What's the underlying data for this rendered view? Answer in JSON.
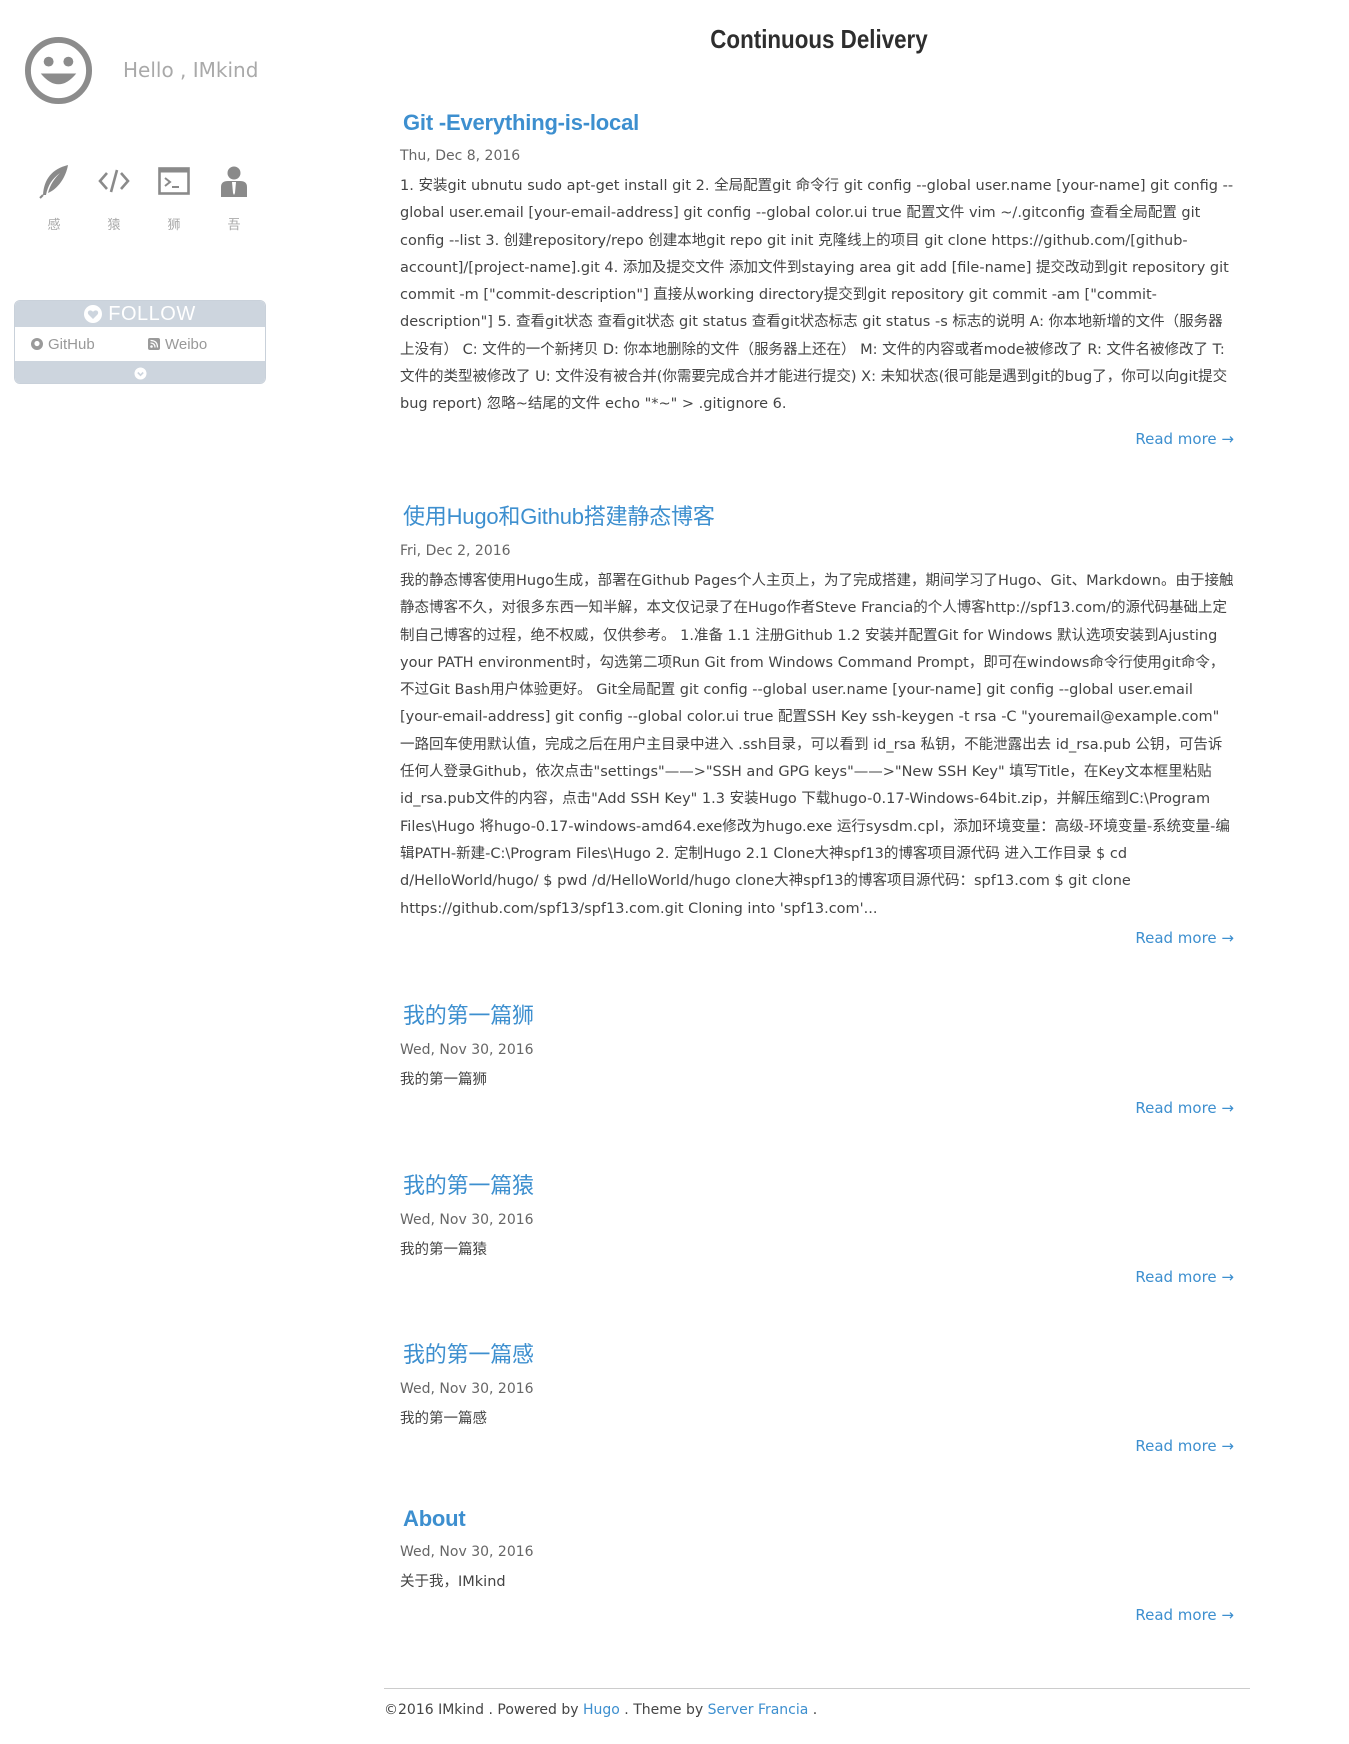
{
  "site": {
    "title": "Continuous Delivery",
    "greeting": "Hello , IMkind"
  },
  "sidebar": {
    "categories": [
      {
        "icon": "feather-icon",
        "label": "感"
      },
      {
        "icon": "code-icon",
        "label": "猿"
      },
      {
        "icon": "terminal-icon",
        "label": "狮"
      },
      {
        "icon": "user-icon",
        "label": "吾"
      }
    ],
    "follow": {
      "heading": "FOLLOW",
      "links": [
        {
          "icon": "github-icon",
          "label": "GitHub"
        },
        {
          "icon": "weibo-icon",
          "label": "Weibo"
        }
      ]
    }
  },
  "posts": [
    {
      "title": "Git -Everything-is-local",
      "date": "Thu, Dec 8, 2016",
      "summary": "1. 安装git ubnutu sudo apt-get install git 2. 全局配置git 命令行 git config --global user.name [your-name] git config --global user.email [your-email-address] git config --global color.ui true 配置文件 vim ~/.gitconfig 查看全局配置 git config --list 3. 创建repository/repo 创建本地git repo git init 克隆线上的项目 git clone https://github.com/[github-account]/[project-name].git 4. 添加及提交文件 添加文件到staying area git add [file-name] 提交改动到git repository git commit -m [\"commit-description\"] 直接从working directory提交到git repository git commit -am [\"commit-description\"] 5. 查看git状态 查看git状态 git status 查看git状态标志 git status -s 标志的说明 A: 你本地新增的文件（服务器上没有） C: 文件的一个新拷贝 D: 你本地删除的文件（服务器上还在） M: 文件的内容或者mode被修改了 R: 文件名被修改了 T: 文件的类型被修改了 U: 文件没有被合并(你需要完成合并才能进行提交) X: 未知状态(很可能是遇到git的bug了，你可以向git提交bug report) 忽略~结尾的文件 echo \"*~\" > .gitignore 6.",
      "read_more": "Read more →"
    },
    {
      "title": "使用Hugo和Github搭建静态博客",
      "date": "Fri, Dec 2, 2016",
      "summary": "我的静态博客使用Hugo生成，部署在Github Pages个人主页上，为了完成搭建，期间学习了Hugo、Git、Markdown。由于接触静态博客不久，对很多东西一知半解，本文仅记录了在Hugo作者Steve Francia的个人博客http://spf13.com/的源代码基础上定制自己博客的过程，绝不权威，仅供参考。 1.准备 1.1 注册Github 1.2 安装并配置Git for Windows 默认选项安装到Ajusting your PATH environment时，勾选第二项Run Git from Windows Command Prompt，即可在windows命令行使用git命令，不过Git Bash用户体验更好。 Git全局配置 git config --global user.name [your-name] git config --global user.email [your-email-address] git config --global color.ui true 配置SSH Key ssh-keygen -t rsa -C \"youremail@example.com\" 一路回车使用默认值，完成之后在用户主目录中进入 .ssh目录，可以看到 id_rsa 私钥，不能泄露出去 id_rsa.pub 公钥，可告诉任何人登录Github，依次点击\"settings\"——>\"SSH and GPG keys\"——>\"New SSH Key\" 填写Title，在Key文本框里粘贴id_rsa.pub文件的内容，点击\"Add SSH Key\" 1.3 安装Hugo 下载hugo-0.17-Windows-64bit.zip，并解压缩到C:\\Program Files\\Hugo 将hugo-0.17-windows-amd64.exe修改为hugo.exe 运行sysdm.cpl，添加环境变量：高级-环境变量-系统变量-编辑PATH-新建-C:\\Program Files\\Hugo 2. 定制Hugo 2.1 Clone大神spf13的博客项目源代码 进入工作目录 $ cd d/HelloWorld/hugo/ $ pwd /d/HelloWorld/hugo clone大神spf13的博客项目源代码：spf13.com $ git clone https://github.com/spf13/spf13.com.git Cloning into 'spf13.com'...",
      "read_more": "Read more →"
    },
    {
      "title": "我的第一篇狮",
      "date": "Wed, Nov 30, 2016",
      "summary": "我的第一篇狮",
      "read_more": "Read more →"
    },
    {
      "title": "我的第一篇猿",
      "date": "Wed, Nov 30, 2016",
      "summary": "我的第一篇猿",
      "read_more": "Read more →"
    },
    {
      "title": "我的第一篇感",
      "date": "Wed, Nov 30, 2016",
      "summary": "我的第一篇感",
      "read_more": "Read more →"
    },
    {
      "title": "About",
      "date": "Wed, Nov 30, 2016",
      "summary": "关于我，IMkind",
      "read_more": "Read more →"
    }
  ],
  "footer": {
    "copyright": "©2016 IMkind . Powered by ",
    "hugo_link": "Hugo",
    "theme_by": " . Theme by ",
    "theme_link": "Server Francia",
    "end": " ."
  },
  "colors": {
    "accent": "#3d8fcf",
    "icon_gray": "#8a8a8a",
    "follow_bg": "#cdd5de"
  }
}
